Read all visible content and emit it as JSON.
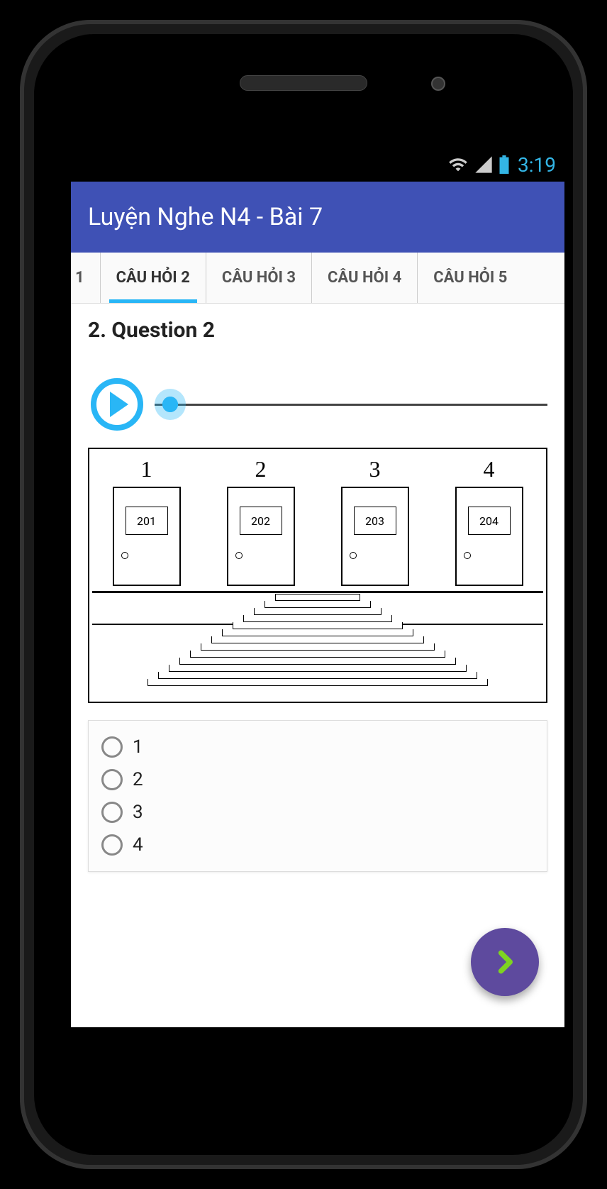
{
  "statusbar": {
    "time": "3:19"
  },
  "appbar": {
    "title": "Luyện Nghe N4 - Bài 7"
  },
  "tabs": {
    "items": [
      {
        "label": "1"
      },
      {
        "label": "CÂU HỎI 2"
      },
      {
        "label": "CÂU HỎI 3"
      },
      {
        "label": "CÂU HỎI 4"
      },
      {
        "label": "CÂU HỎI 5"
      }
    ],
    "active_index": 1
  },
  "question": {
    "title": "2. Question 2",
    "doors": [
      {
        "num": "1",
        "room": "201"
      },
      {
        "num": "2",
        "room": "202"
      },
      {
        "num": "3",
        "room": "203"
      },
      {
        "num": "4",
        "room": "204"
      }
    ],
    "answers": [
      {
        "label": "1"
      },
      {
        "label": "2"
      },
      {
        "label": "3"
      },
      {
        "label": "4"
      }
    ]
  }
}
